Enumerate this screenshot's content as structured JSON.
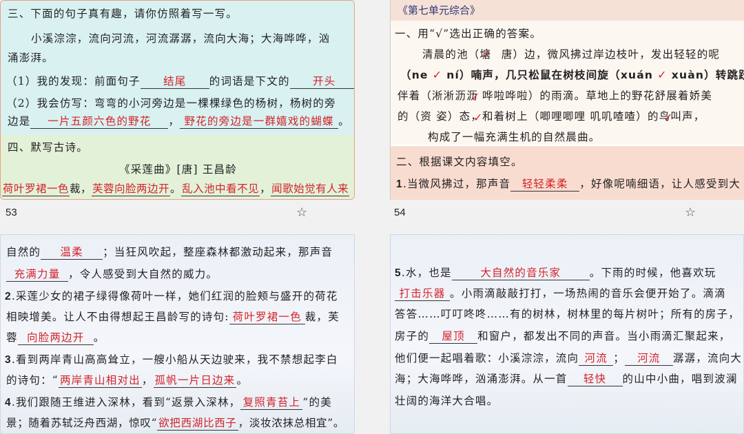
{
  "s1": {
    "l1": "三、下面的句子真有趣，请你仿照着写一写。",
    "l2": "小溪淙淙，流向河流，河流潺潺，流向大海；大海哗哗，汹",
    "l3": "涌澎湃。",
    "l4a": "（1）我的发现：前面句子",
    "l4b": "结尾",
    "l4c": "的词语是下文的",
    "l4d": "开头",
    "l4e": "。",
    "l5": "（2）我会仿写：弯弯的小河旁边是一棵棵绿色的杨树，杨树的旁",
    "l6a": "边是",
    "l6b": "一片五颜六色的野花",
    "l6c": "，",
    "l6d": "野花的旁边是一群嬉戏的蝴蝶",
    "l6e": "。",
    "l7": "四、默写古诗。",
    "l8": "《采莲曲》[唐] 王昌龄",
    "p1": "荷叶罗裙一色",
    "p1s": "裁，",
    "p2": "芙蓉向脸两边开",
    "p2s": "。",
    "p3": "乱入池中看不见",
    "p3s": "，",
    "p4": "闻歌始觉有人来",
    "page": "53"
  },
  "s2": {
    "title": "《第七单元综合》",
    "l1": "一、用“√”选出正确的答案。",
    "l2a": "清晨的池（塘",
    "l2b": "唐）边，微风拂过岸边枝叶，发出轻轻的呢",
    "l3a": "（ne",
    "l3b": "ní）喃声，几只松鼠在树枝间旋（xuán",
    "l3c": "xuàn）转跳跃，",
    "l4": "伴着（淅淅沥沥   哗啦哗啦）的雨滴。草地上的野花舒展着娇美",
    "l5": "的（资   姿）态，和着树上（唧哩唧哩   叽叽喳喳）的鸟叫声，",
    "l6": "构成了一幅充满生机的自然晨曲。",
    "l7": "二、根据课文内容填空。",
    "l8a": "1",
    "l8b": ".当微风拂过，那声音",
    "l8c": "轻轻柔柔",
    "l8d": "，好像呢喃细语，让人感受到大",
    "page": "54"
  },
  "s3": {
    "l1a": "自然的",
    "l1b": "温柔",
    "l1c": "；当狂风吹起，整座森林都激动起来，那声音",
    "l2a": "充满力量",
    "l2b": "，令人感受到大自然的威力。",
    "l3a": "2",
    "l3b": ".采莲少女的裙子绿得像荷叶一样，她们红润的脸颊与盛开的荷花",
    "l4a": "相映增美。让人不由得想起王昌龄写的诗句:",
    "l4b": "荷叶罗裙一色",
    "l4c": "裁，芙",
    "l5a": "蓉",
    "l5b": "向脸两边开",
    "l5c": "。",
    "l6a": "3",
    "l6b": ".看到两岸青山高高耸立，一艘小船从天边驶来，我不禁想起李白",
    "l7a": "的诗句：“",
    "l7b": "两岸青山相对出",
    "l7c": "，",
    "l7d": "孤帆一片日边来",
    "l7e": "。",
    "l8a": "4",
    "l8b": ".我们跟随王维进入深林，看到“返景入深林，",
    "l8c": "复照青苔上",
    "l8d": "”的美",
    "l9a": "景；随着苏轼泛舟西湖，惊叹“",
    "l9b": "欲把西湖比西子",
    "l9c": "，淡妆浓抹总相宜”。"
  },
  "s4": {
    "l1a": "5",
    "l1b": ".水，也是",
    "l1c": "大自然的音乐家",
    "l1d": "。下雨的时候，他喜欢玩",
    "l2a": "打击乐器",
    "l2b": "。小雨滴敲敲打打，一场热闹的音乐会便开始了。滴滴",
    "l3": "答答……叮叮咚咚……有的树林，树林里的每片树叶；所有的房子，",
    "l4a": "房子的",
    "l4b": "屋顶",
    "l4c": "和窗户，都发出不同的声音。当小雨滴汇聚起来，",
    "l5a": "他们便一起唱着歌：小溪淙淙，流向",
    "l5b": "河流",
    "l5c": "；",
    "l5d": "河流",
    "l5e": "潺潺，流向大",
    "l6": "海；大海哗哗，汹涌澎湃。从一首",
    "l6b": "轻快",
    "l6c": "的山中小曲，唱到波澜",
    "l7": "壮阔的海洋大合唱。"
  },
  "checks": [
    "✓",
    "✓",
    "✓",
    "✓",
    "✓",
    "✓"
  ]
}
